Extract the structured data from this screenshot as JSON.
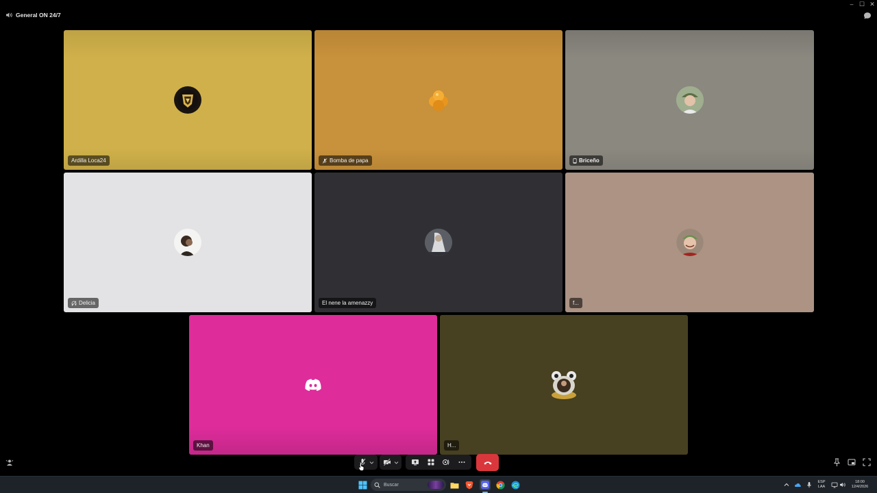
{
  "channel": {
    "name": "General ON 24/7"
  },
  "window": {
    "minimize": "–",
    "maximize": "☐",
    "close": "✕"
  },
  "participants": [
    {
      "name": "Ardilla Loca24",
      "bg": "#cfb04a",
      "icon": ""
    },
    {
      "name": "Bomba de papa",
      "bg": "#c8913b",
      "icon": "muted-mic-icon"
    },
    {
      "name": "Briceño",
      "bg": "#8b8880",
      "icon": "phone-icon"
    },
    {
      "name": "Delicia",
      "bg": "#e3e3e5",
      "icon": "deafened-icon"
    },
    {
      "name": "El nene la amenazzy",
      "bg": "#303034",
      "icon": ""
    },
    {
      "name": "f...",
      "bg": "#ac9384",
      "icon": ""
    },
    {
      "name": "Khan",
      "bg": "#de2c9b",
      "icon": ""
    },
    {
      "name": "H...",
      "bg": "#474021",
      "icon": ""
    }
  ],
  "controls": {
    "mic": "muted-mic-icon",
    "camera": "camera-off-icon",
    "share": "screen-share-icon",
    "activities": "activities-icon",
    "soundboard": "soundboard-icon",
    "more": "more-icon",
    "disconnect": "hang-up-icon"
  },
  "taskbar": {
    "search_placeholder": "Buscar",
    "lang": "ESP",
    "lang_sub": "LAA",
    "time": "18:00",
    "date": "12/4/2026"
  },
  "colors": {
    "hangup": "#da373c",
    "discord_blurple": "#5865f2"
  }
}
